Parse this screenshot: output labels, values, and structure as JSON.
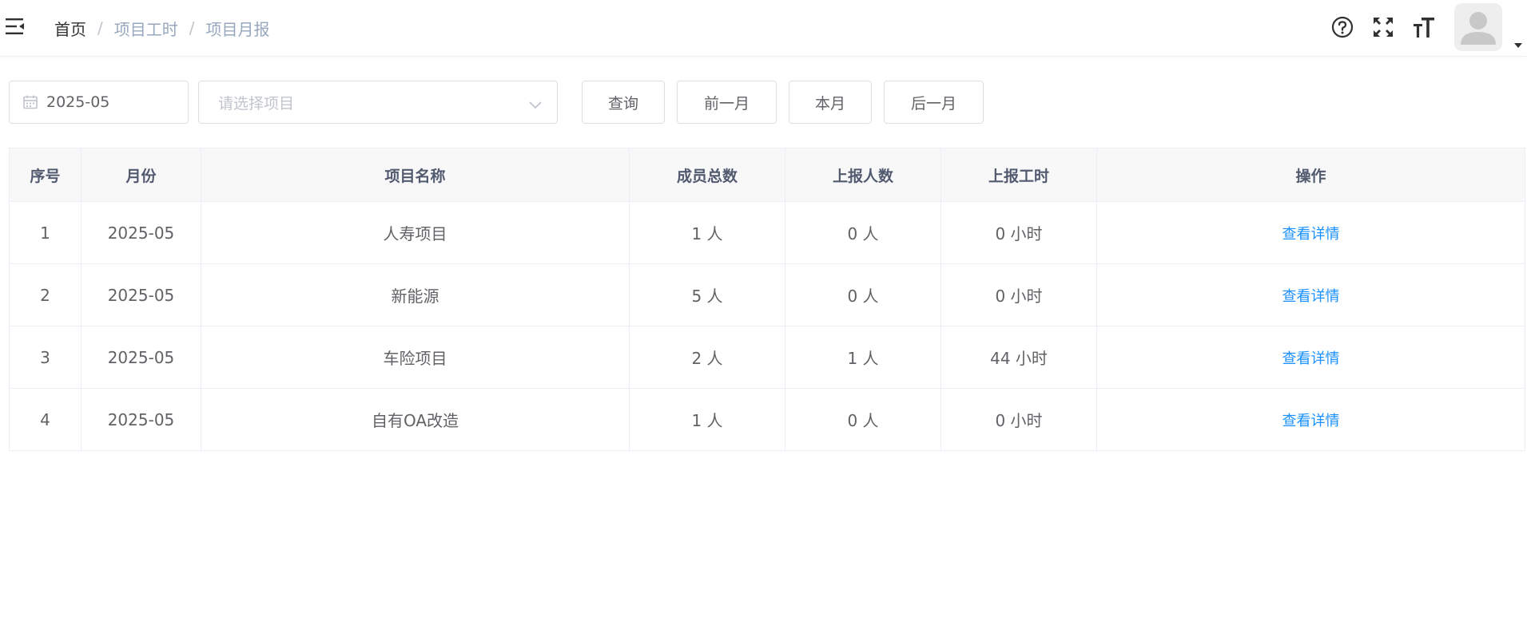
{
  "header": {
    "breadcrumb": {
      "home": "首页",
      "separator": "/",
      "level1": "项目工时",
      "level2": "项目月报"
    },
    "icons": [
      "menu-fold-icon",
      "question-circle-icon",
      "fullscreen-icon",
      "font-size-icon",
      "user-avatar-icon",
      "caret-down-icon"
    ]
  },
  "filters": {
    "month_value": "2025-05",
    "project_placeholder": "请选择项目",
    "buttons": {
      "query": "查询",
      "prev_month": "前一月",
      "this_month": "本月",
      "next_month": "后一月"
    }
  },
  "table": {
    "columns": [
      "序号",
      "月份",
      "项目名称",
      "成员总数",
      "上报人数",
      "上报工时",
      "操作"
    ],
    "rows": [
      {
        "index": "1",
        "month": "2025-05",
        "project": "人寿项目",
        "members": "1 人",
        "reported": "0 人",
        "hours": "0 小时",
        "action": "查看详情"
      },
      {
        "index": "2",
        "month": "2025-05",
        "project": "新能源",
        "members": "5 人",
        "reported": "0 人",
        "hours": "0 小时",
        "action": "查看详情"
      },
      {
        "index": "3",
        "month": "2025-05",
        "project": "车险项目",
        "members": "2 人",
        "reported": "1 人",
        "hours": "44 小时",
        "action": "查看详情"
      },
      {
        "index": "4",
        "month": "2025-05",
        "project": "自有OA改造",
        "members": "1 人",
        "reported": "0 人",
        "hours": "0 小时",
        "action": "查看详情"
      }
    ]
  },
  "colors": {
    "link": "#1890ff",
    "header_bg": "#f8f8f9",
    "border": "#ebeef5"
  }
}
